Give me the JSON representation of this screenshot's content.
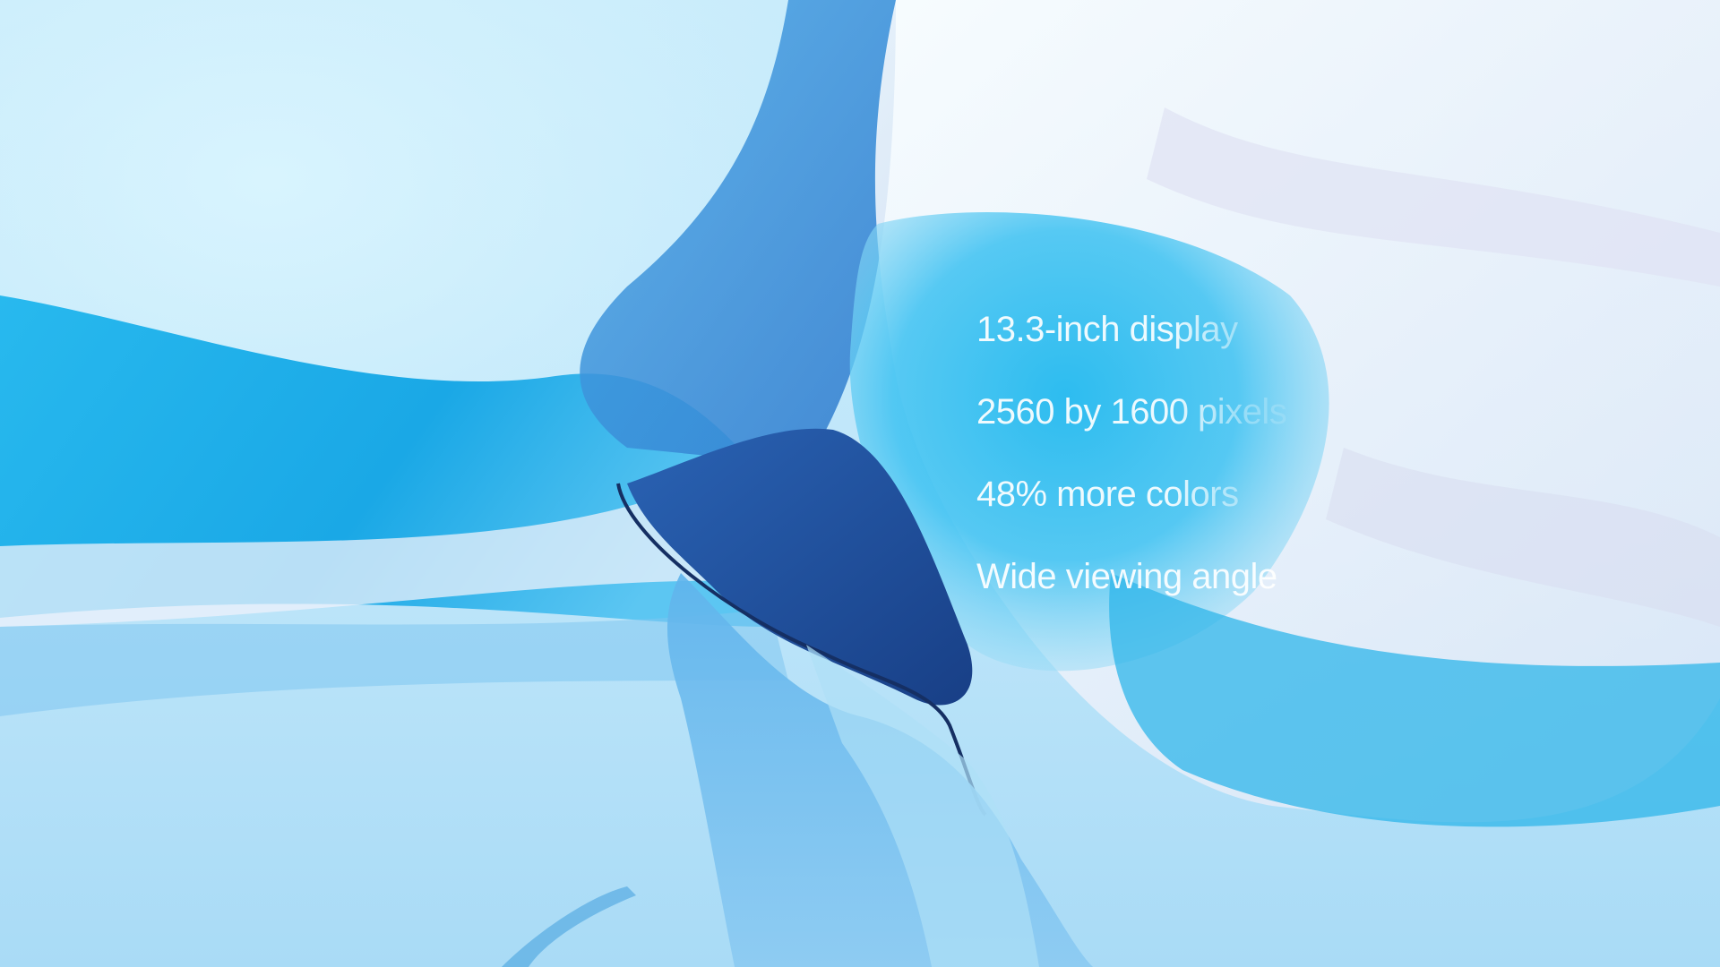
{
  "specs": {
    "items": [
      {
        "text": "13.3-inch display"
      },
      {
        "text": "2560 by 1600 pixels"
      },
      {
        "text": "48% more colors"
      },
      {
        "text": "Wide viewing angle"
      }
    ]
  },
  "colors": {
    "background": "#c9ecfb",
    "fabric_cyan": "#1fb8ea",
    "fabric_blue": "#3f8fd8",
    "fabric_navy": "#1f4f9a",
    "fabric_white": "#eef0fa",
    "text": "#ffffff"
  }
}
